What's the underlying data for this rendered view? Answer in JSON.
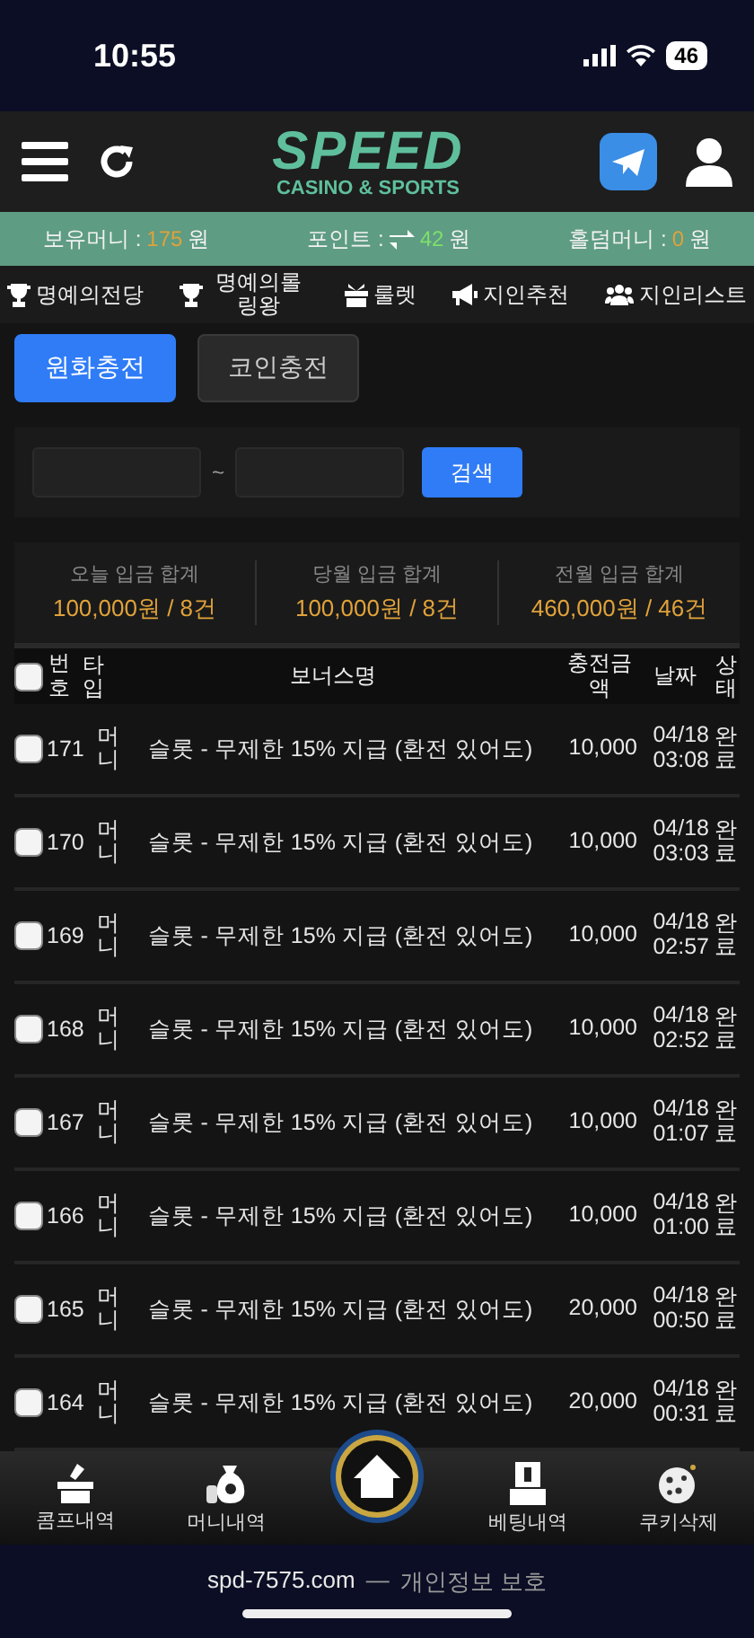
{
  "status_bar": {
    "time": "10:55",
    "battery": "46"
  },
  "header": {
    "logo_title": "SPEED",
    "logo_subtitle": "CASINO & SPORTS"
  },
  "balance": [
    {
      "label": "보유머니 :",
      "kind": "plain",
      "value": "175",
      "unit": "원",
      "color": "#e0a23a"
    },
    {
      "label": "포인트 :",
      "kind": "exchange",
      "value": "42",
      "unit": "원",
      "color": "#7ee06a"
    },
    {
      "label": "홀덤머니 :",
      "kind": "plain",
      "value": "0",
      "unit": "원",
      "color": "#e0a23a"
    }
  ],
  "nav_links": [
    {
      "label": "명예의전당",
      "kind": "trophy"
    },
    {
      "label": "명예의롤링왕",
      "kind": "trophy"
    },
    {
      "label": "룰렛",
      "kind": "gift"
    },
    {
      "label": "지인추천",
      "kind": "megaphone"
    },
    {
      "label": "지인리스트",
      "kind": "users"
    }
  ],
  "tabs": [
    {
      "label": "원화충전",
      "selected": true
    },
    {
      "label": "코인충전",
      "selected": false
    }
  ],
  "search": {
    "separator": "~",
    "button": "검색"
  },
  "summary": [
    {
      "label": "오늘 입금 합계",
      "value": "100,000원 / 8건"
    },
    {
      "label": "당월 입금 합계",
      "value": "100,000원 / 8건"
    },
    {
      "label": "전월 입금 합계",
      "value": "460,000원 / 46건"
    }
  ],
  "table": {
    "select_all_checked": false,
    "columns": [
      "번호",
      "타입",
      "보너스명",
      "충전금액",
      "날짜",
      "상태"
    ],
    "rows": [
      {
        "checked": false,
        "number": "171",
        "type": "머니",
        "bonus": "슬롯 - 무제한 15% 지급 (환전 있어도)",
        "amount": "10,000",
        "date": "04/18 03:08",
        "status": "완료"
      },
      {
        "checked": false,
        "number": "170",
        "type": "머니",
        "bonus": "슬롯 - 무제한 15% 지급 (환전 있어도)",
        "amount": "10,000",
        "date": "04/18 03:03",
        "status": "완료"
      },
      {
        "checked": false,
        "number": "169",
        "type": "머니",
        "bonus": "슬롯 - 무제한 15% 지급 (환전 있어도)",
        "amount": "10,000",
        "date": "04/18 02:57",
        "status": "완료"
      },
      {
        "checked": false,
        "number": "168",
        "type": "머니",
        "bonus": "슬롯 - 무제한 15% 지급 (환전 있어도)",
        "amount": "10,000",
        "date": "04/18 02:52",
        "status": "완료"
      },
      {
        "checked": false,
        "number": "167",
        "type": "머니",
        "bonus": "슬롯 - 무제한 15% 지급 (환전 있어도)",
        "amount": "10,000",
        "date": "04/18 01:07",
        "status": "완료"
      },
      {
        "checked": false,
        "number": "166",
        "type": "머니",
        "bonus": "슬롯 - 무제한 15% 지급 (환전 있어도)",
        "amount": "10,000",
        "date": "04/18 01:00",
        "status": "완료"
      },
      {
        "checked": false,
        "number": "165",
        "type": "머니",
        "bonus": "슬롯 - 무제한 15% 지급 (환전 있어도)",
        "amount": "20,000",
        "date": "04/18 00:50",
        "status": "완료"
      },
      {
        "checked": false,
        "number": "164",
        "type": "머니",
        "bonus": "슬롯 - 무제한 15% 지급 (환전 있어도)",
        "amount": "20,000",
        "date": "04/18 00:31",
        "status": "완료"
      }
    ]
  },
  "bottom_nav": [
    {
      "label": "콤프내역",
      "kind": "ballot"
    },
    {
      "label": "머니내역",
      "kind": "moneybag"
    },
    {
      "kind": "home"
    },
    {
      "label": "베팅내역",
      "kind": "ticket"
    },
    {
      "label": "쿠키삭제",
      "kind": "cookie"
    }
  ],
  "footer": {
    "url": "spd-7575.com",
    "separator": "—",
    "note": "개인정보 보호"
  }
}
